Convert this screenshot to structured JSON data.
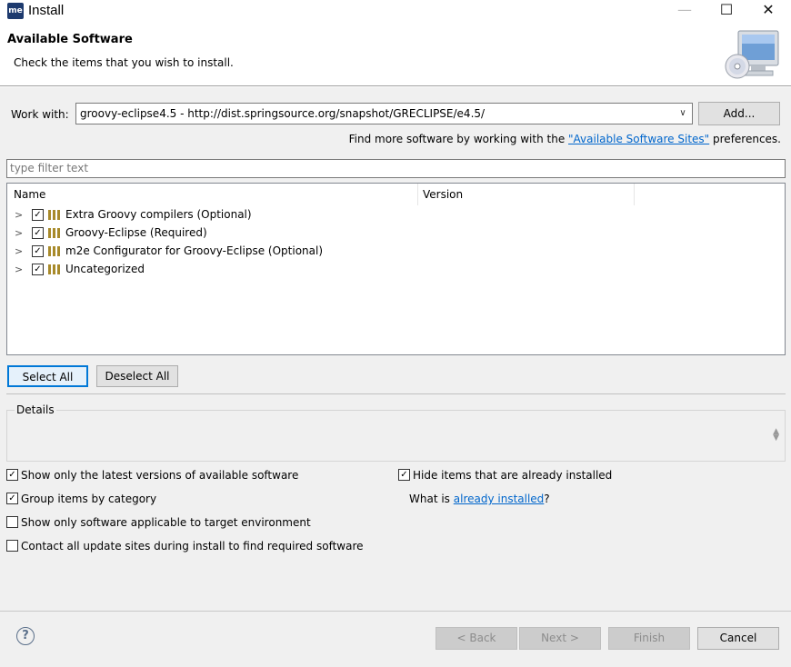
{
  "window": {
    "app_icon_text": "me",
    "title": "Install",
    "minimize_glyph": "—",
    "maximize_glyph": "☐",
    "close_glyph": "✕"
  },
  "header": {
    "title": "Available Software",
    "description": "Check the items that you wish to install.",
    "icon": "computer-cd-icon"
  },
  "work_with": {
    "label": "Work with:",
    "value": "groovy-eclipse4.5 - http://dist.springsource.org/snapshot/GRECLIPSE/e4.5/",
    "add_label": "Add..."
  },
  "find_more": {
    "prefix": "Find more software by working with the ",
    "link": "\"Available Software Sites\"",
    "suffix": " preferences."
  },
  "filter": {
    "placeholder": "type filter text"
  },
  "tree": {
    "columns": [
      "Name",
      "Version"
    ],
    "rows": [
      {
        "label": "Extra Groovy compilers (Optional)",
        "checked": true
      },
      {
        "label": "Groovy-Eclipse (Required)",
        "checked": true
      },
      {
        "label": "m2e Configurator for Groovy-Eclipse (Optional)",
        "checked": true
      },
      {
        "label": "Uncategorized",
        "checked": true
      }
    ]
  },
  "buttons": {
    "select_all": "Select All",
    "deselect_all": "Deselect All",
    "back": "< Back",
    "next": "Next >",
    "finish": "Finish",
    "cancel": "Cancel"
  },
  "details": {
    "label": "Details"
  },
  "options": {
    "latest": {
      "label": "Show only the latest versions of available software",
      "checked": true
    },
    "group": {
      "label": "Group items by category",
      "checked": true
    },
    "target": {
      "label": "Show only software applicable to target environment",
      "checked": false
    },
    "contact": {
      "label": "Contact all update sites during install to find required software",
      "checked": false
    },
    "hide": {
      "label": "Hide items that are already installed",
      "checked": true
    }
  },
  "what_is": {
    "prefix": "What is ",
    "link": "already installed",
    "suffix": "?"
  },
  "colors": {
    "link": "#0066cc",
    "focus_border": "#0078d7",
    "dialog_bg": "#f0f0f0"
  }
}
